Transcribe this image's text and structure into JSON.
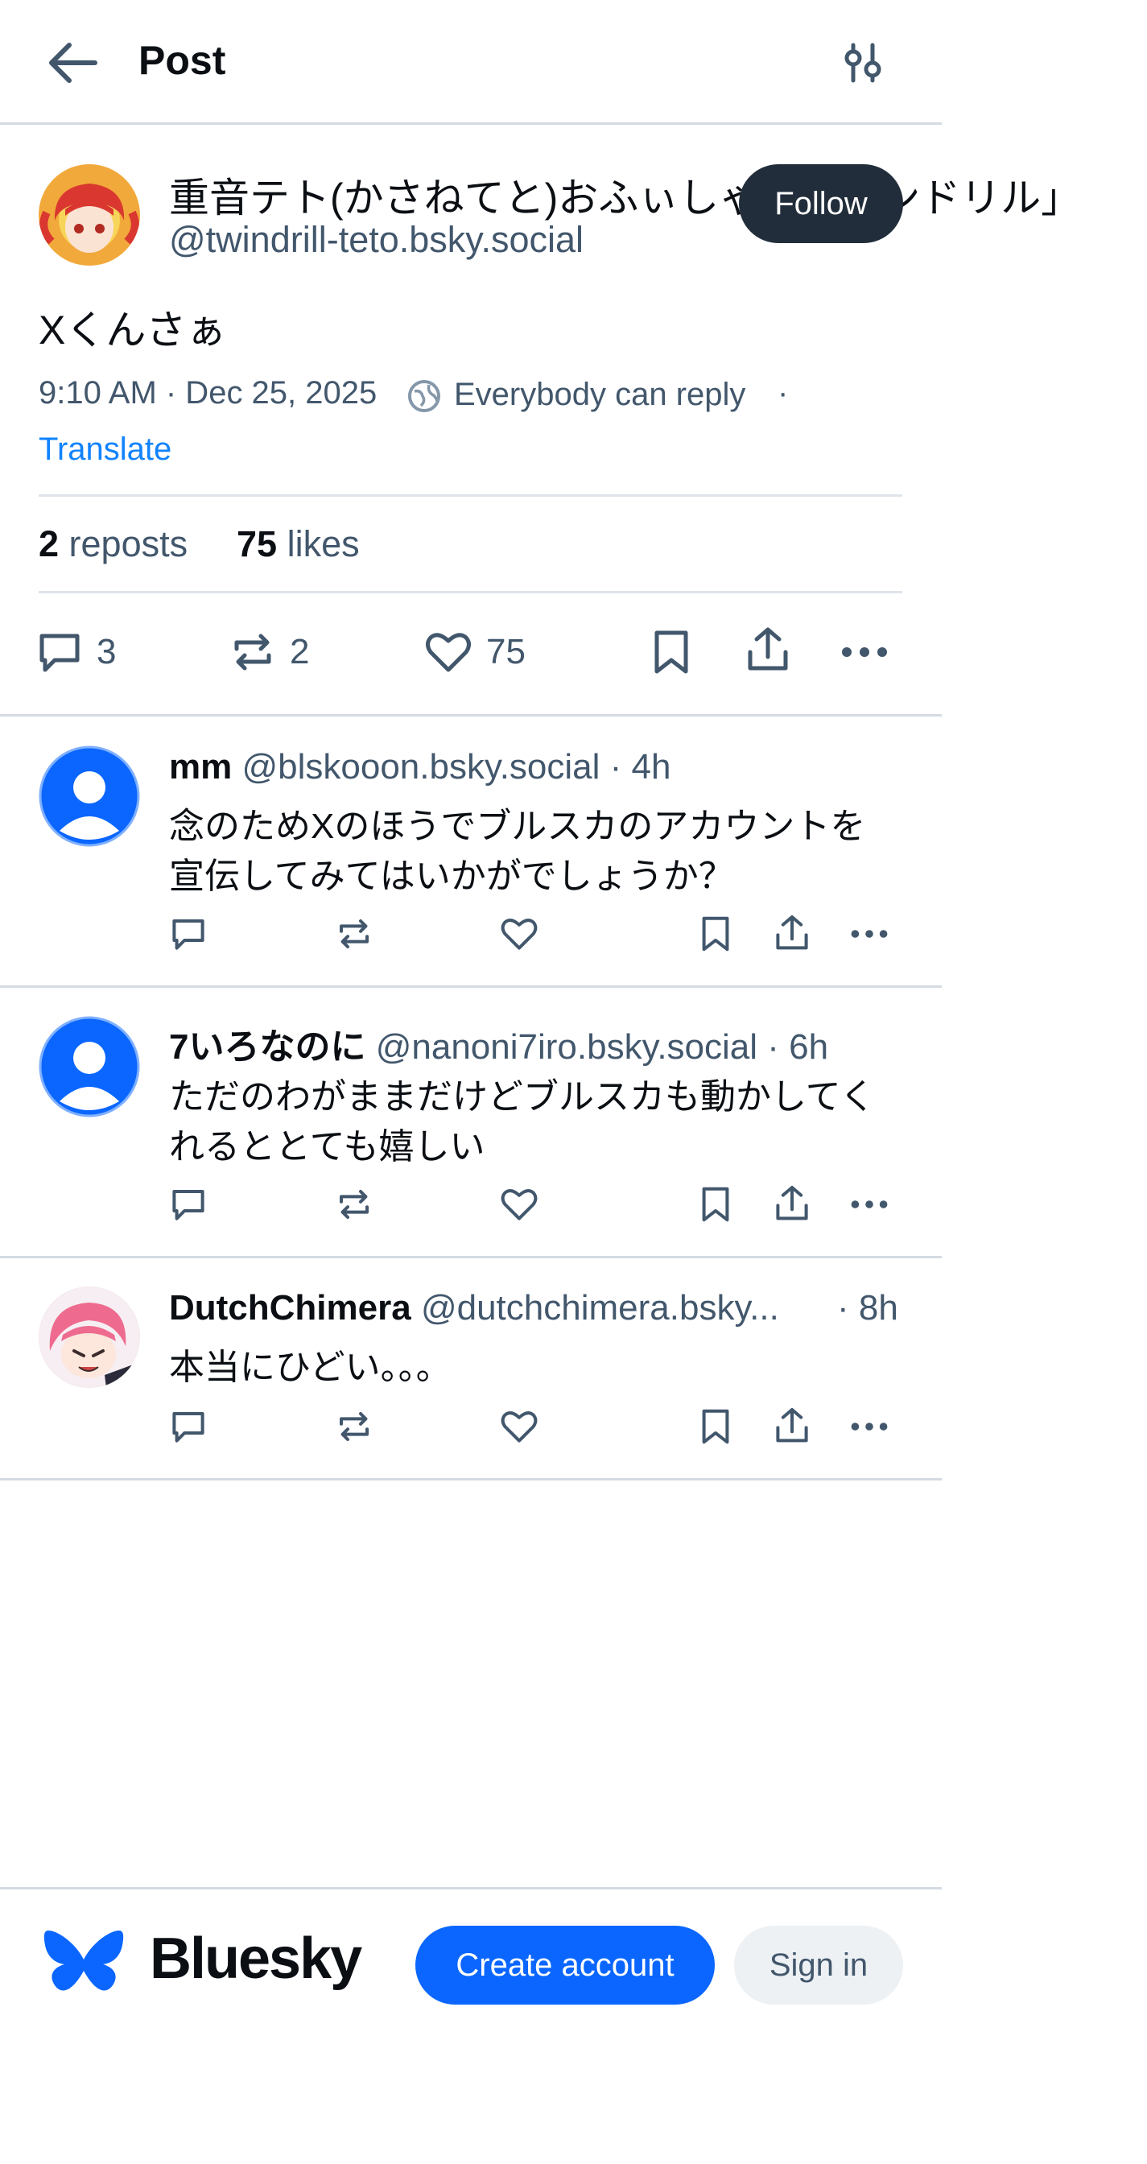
{
  "header": {
    "title": "Post"
  },
  "post": {
    "author_name": "重音テト(かさねてと)おふぃしゃ「ツインドリル」",
    "author_handle": "@twindrill-teto.bsky.social",
    "follow_label": "Follow",
    "text": "Xくんさぁ",
    "timestamp": "9:10 AM · Dec 25, 2025",
    "reply_setting": "Everybody can reply",
    "separator": "·",
    "translate_label": "Translate",
    "reposts_count": "2",
    "reposts_label": "reposts",
    "likes_count": "75",
    "likes_label": "likes",
    "reply_count": "3",
    "repost_count": "2",
    "like_count": "75"
  },
  "replies": [
    {
      "name": "mm",
      "handle": "@blskooon.bsky.social",
      "time": "· 4h",
      "text_line1": "念のためXのほうでブルスカのアカウントを",
      "text_line2": "宣伝してみてはいかがでしょうか？"
    },
    {
      "name": "7いろなのに",
      "handle": "@nanoni7iro.bsky.social",
      "time": "· 6h",
      "text_line1": "ただのわがままだけどブルスカも動かしてく",
      "text_line2": "れるととても嬉しい"
    },
    {
      "name": "DutchChimera",
      "handle": "@dutchchimera.bsky...",
      "time": "· 8h",
      "text_line1": "本当にひどい。。。",
      "text_line2": ""
    }
  ],
  "footer": {
    "brand": "Bluesky",
    "create_account": "Create account",
    "sign_in": "Sign in"
  },
  "colors": {
    "accent": "#0a66ff",
    "follow_bg": "#222d3b",
    "muted_text": "#42576c",
    "link": "#1083fe"
  }
}
